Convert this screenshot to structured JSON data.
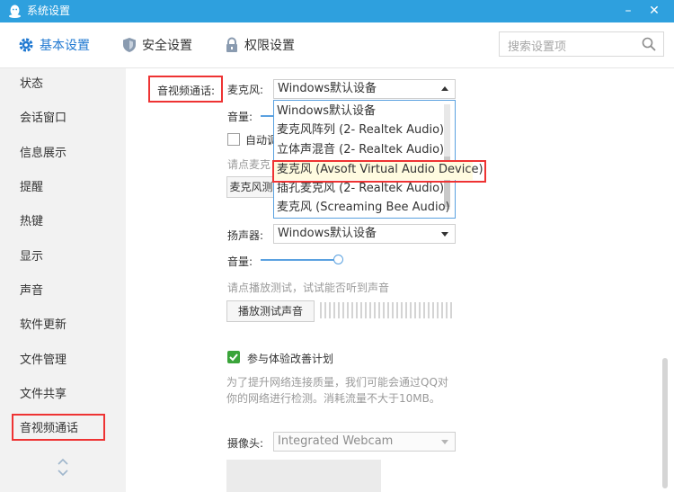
{
  "window": {
    "title": "系统设置",
    "minimize_label": "–",
    "close_label": "✕"
  },
  "tabs": [
    {
      "label": "基本设置",
      "icon": "gear-icon",
      "active": true
    },
    {
      "label": "安全设置",
      "icon": "shield-icon",
      "active": false
    },
    {
      "label": "权限设置",
      "icon": "lock-icon",
      "active": false
    }
  ],
  "search": {
    "placeholder": "搜索设置项",
    "icon": "search-icon"
  },
  "sidebar": {
    "items": [
      {
        "label": "状态"
      },
      {
        "label": "会话窗口"
      },
      {
        "label": "信息展示"
      },
      {
        "label": "提醒"
      },
      {
        "label": "热键"
      },
      {
        "label": "显示"
      },
      {
        "label": "声音"
      },
      {
        "label": "软件更新"
      },
      {
        "label": "文件管理"
      },
      {
        "label": "文件共享"
      },
      {
        "label": "音视频通话",
        "active": true
      }
    ]
  },
  "main": {
    "section_title": "音视频通话:",
    "microphone": {
      "label": "麦克风:",
      "selected": "Windows默认设备",
      "volume_label": "音量:",
      "auto_adjust_label": "自动调",
      "test_hint": "请点麦克",
      "test_button": "麦克风测",
      "options": [
        "Windows默认设备",
        "麦克风阵列 (2- Realtek Audio)",
        "立体声混音 (2- Realtek Audio)",
        "麦克风 (Avsoft Virtual Audio Device)",
        "插孔麦克风 (2- Realtek Audio)",
        "麦克风 (Screaming Bee Audio)"
      ],
      "highlighted_option_index": 3
    },
    "speaker": {
      "label": "扬声器:",
      "selected": "Windows默认设备",
      "volume_label": "音量:",
      "volume_fraction": 0.8,
      "test_hint": "请点播放测试，试试能否听到声音",
      "test_button": "播放测试声音"
    },
    "experience_program": {
      "label": "参与体验改善计划",
      "checked": true,
      "description_line1": "为了提升网络连接质量，我们可能会通过QQ对",
      "description_line2": "你的网络进行检测。消耗流量不大于10MB。"
    },
    "camera": {
      "label": "摄像头:",
      "selected": "Integrated Webcam"
    }
  },
  "colors": {
    "titlebar": "#2ea0de",
    "accent": "#1f78d1",
    "highlight_box": "#e33333",
    "checkbox": "#3aa43a"
  }
}
